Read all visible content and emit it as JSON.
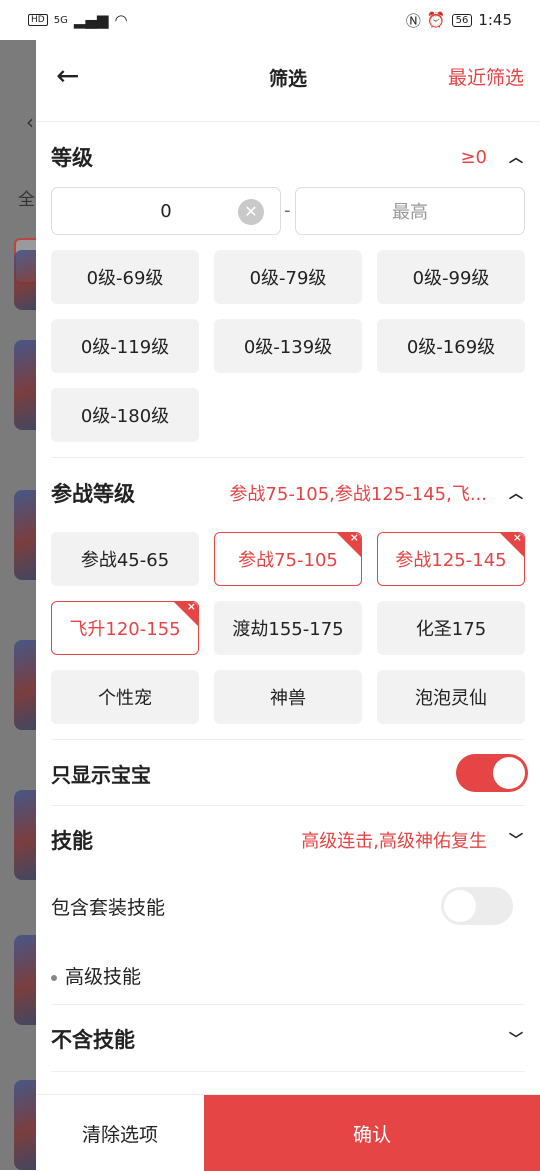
{
  "status_bar": {
    "time": "1:45",
    "battery": "56",
    "hd": "HD",
    "signal": "5G"
  },
  "background": {
    "tab_letter": "全"
  },
  "header": {
    "title": "筛选",
    "recent_label": "最近筛选"
  },
  "level": {
    "title": "等级",
    "value": "≥0",
    "min_value": "0",
    "max_placeholder": "最高",
    "separator": "-",
    "chips": [
      "0级-69级",
      "0级-79级",
      "0级-99级",
      "0级-119级",
      "0级-139级",
      "0级-169级",
      "0级-180级"
    ]
  },
  "battle_level": {
    "title": "参战等级",
    "value": "参战75-105,参战125-145,飞...",
    "chips": [
      {
        "label": "参战45-65",
        "selected": false
      },
      {
        "label": "参战75-105",
        "selected": true
      },
      {
        "label": "参战125-145",
        "selected": true
      },
      {
        "label": "飞升120-155",
        "selected": true
      },
      {
        "label": "渡劫155-175",
        "selected": false
      },
      {
        "label": "化圣175",
        "selected": false
      },
      {
        "label": "个性宠",
        "selected": false
      },
      {
        "label": "神兽",
        "selected": false
      },
      {
        "label": "泡泡灵仙",
        "selected": false
      }
    ]
  },
  "baby_only": {
    "label": "只显示宝宝",
    "on": true
  },
  "skills": {
    "title": "技能",
    "value": "高级连击,高级神佑复生",
    "include_set_label": "包含套装技能",
    "include_set_on": false,
    "sub_label": "高级技能"
  },
  "exclude_skills": {
    "title": "不含技能"
  },
  "footer": {
    "clear_label": "清除选项",
    "confirm_label": "确认"
  },
  "colors": {
    "accent": "#e64545"
  }
}
